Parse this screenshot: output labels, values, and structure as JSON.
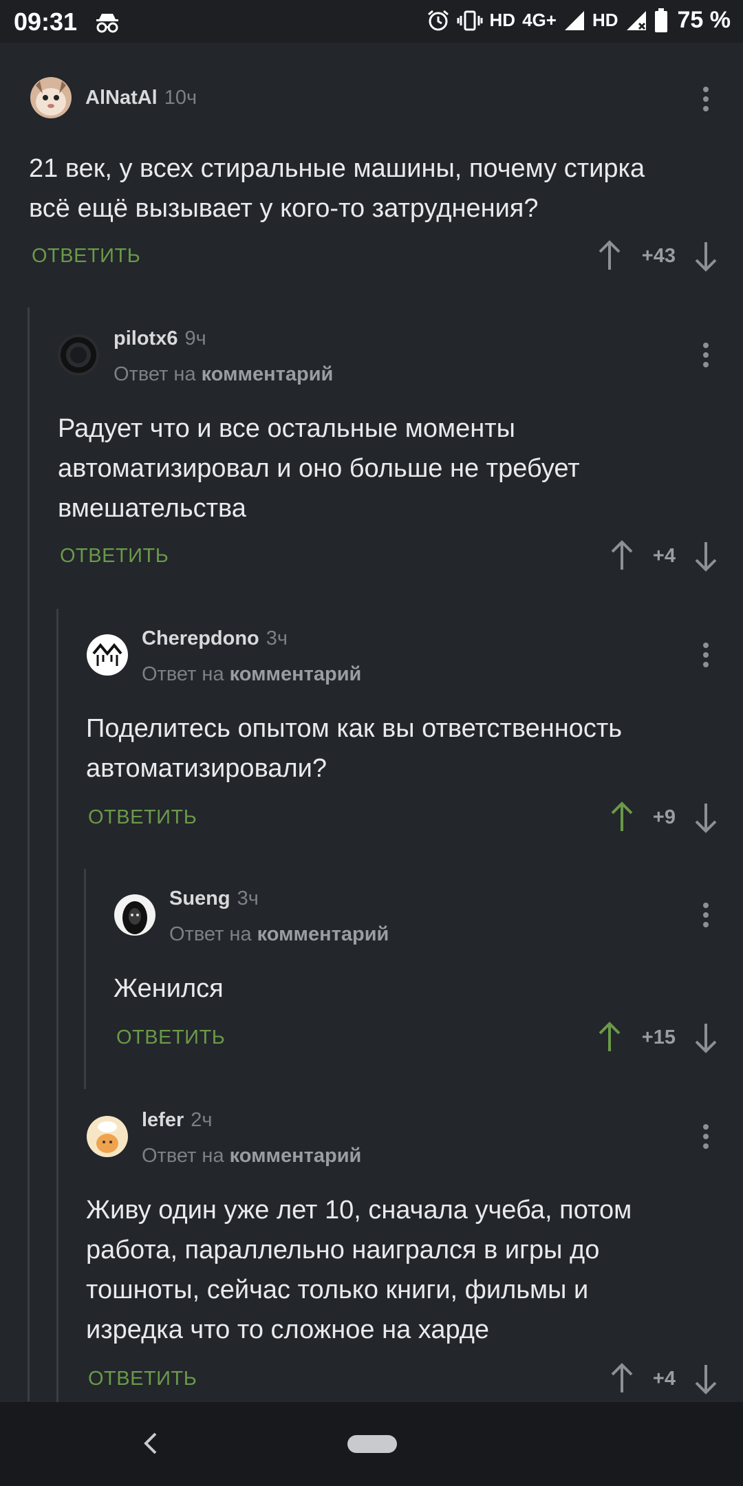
{
  "status_bar": {
    "time": "09:31",
    "hd1": "HD",
    "network": "4G+",
    "hd2": "HD",
    "battery": "75 %"
  },
  "colors": {
    "background": "#23262b",
    "accent_green": "#6a9a49",
    "upvoted": "#6a9a49"
  },
  "comments": [
    {
      "author": "AlNatAl",
      "age": "10ч",
      "reply_prefix": "",
      "reply_target": "",
      "text_lines": [
        "21 век, у всех стиральные машины, почему стирка",
        "всё ещё вызывает у кого-то затруднения?"
      ],
      "answer_label": "ОТВЕТИТЬ",
      "score": "+43",
      "upvoted": false
    },
    {
      "author": "pilotx6",
      "age": "9ч",
      "reply_prefix": "Ответ на",
      "reply_target": "комментарий",
      "text_lines": [
        "Радует что и все остальные моменты",
        "автоматизировал и оно больше не требует",
        "вмешательства"
      ],
      "answer_label": "ОТВЕТИТЬ",
      "score": "+4",
      "upvoted": false
    },
    {
      "author": "Cherepdono",
      "age": "3ч",
      "reply_prefix": "Ответ на",
      "reply_target": "комментарий",
      "text_lines": [
        "Поделитесь опытом как вы ответственность",
        "автоматизировали?"
      ],
      "answer_label": "ОТВЕТИТЬ",
      "score": "+9",
      "upvoted": true
    },
    {
      "author": "Sueng",
      "age": "3ч",
      "reply_prefix": "Ответ на",
      "reply_target": "комментарий",
      "text_lines": [
        "Женился"
      ],
      "answer_label": "ОТВЕТИТЬ",
      "score": "+15",
      "upvoted": true
    },
    {
      "author": "lefer",
      "age": "2ч",
      "reply_prefix": "Ответ на",
      "reply_target": "комментарий",
      "text_lines": [
        "Живу один уже лет 10, сначала учеба, потом",
        "работа, параллельно наигрался в игры до",
        "тошноты, сейчас только книги, фильмы и",
        "изредка что то сложное на харде"
      ],
      "answer_label": "ОТВЕТИТЬ",
      "score": "+4",
      "upvoted": false
    }
  ]
}
